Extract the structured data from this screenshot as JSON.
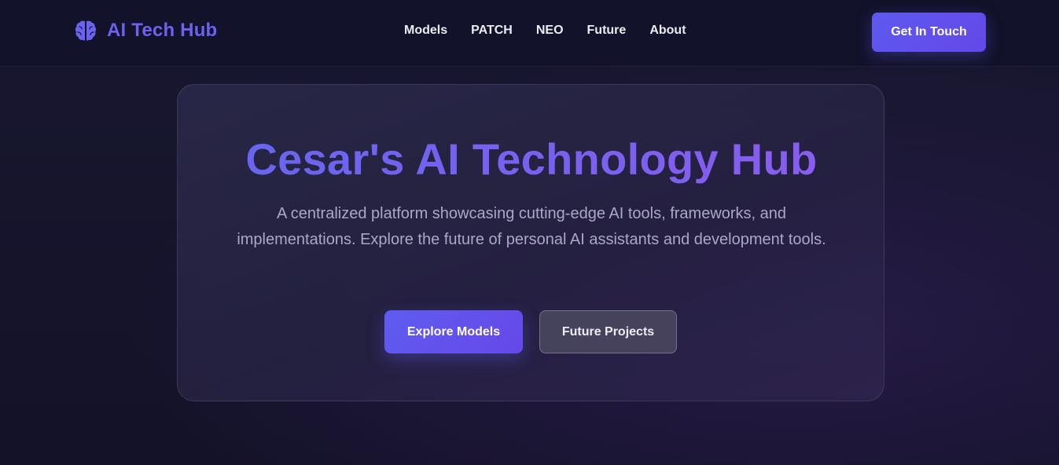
{
  "header": {
    "brand": {
      "icon": "brain-icon",
      "title": "AI Tech Hub"
    },
    "nav": [
      {
        "label": "Models"
      },
      {
        "label": "PATCH"
      },
      {
        "label": "NEO"
      },
      {
        "label": "Future"
      },
      {
        "label": "About"
      }
    ],
    "cta_label": "Get In Touch"
  },
  "hero": {
    "title": "Cesar's AI Technology Hub",
    "description": "A centralized platform showcasing cutting-edge AI tools, frameworks, and implementations. Explore the future of personal AI assistants and development tools.",
    "primary_button": "Explore Models",
    "secondary_button": "Future Projects"
  },
  "colors": {
    "accent": "#5d5af0",
    "accent_purple": "#8c5cf0",
    "background": "#15142a",
    "header_background": "#12122a"
  }
}
